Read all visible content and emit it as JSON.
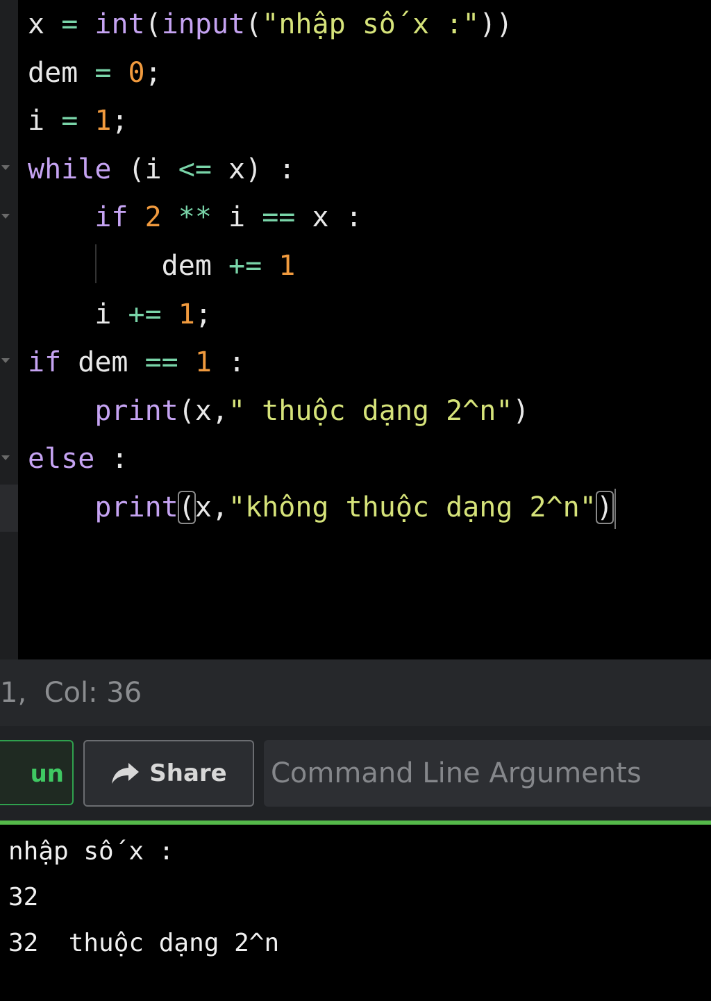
{
  "editor": {
    "lines": [
      [
        {
          "t": "x",
          "c": "pl"
        },
        {
          "t": " ",
          "c": "pl"
        },
        {
          "t": "=",
          "c": "op"
        },
        {
          "t": " ",
          "c": "pl"
        },
        {
          "t": "int",
          "c": "fn"
        },
        {
          "t": "(",
          "c": "pl"
        },
        {
          "t": "input",
          "c": "fn"
        },
        {
          "t": "(",
          "c": "pl"
        },
        {
          "t": "\"nhập số x :\"",
          "c": "str"
        },
        {
          "t": "))",
          "c": "pl"
        }
      ],
      [
        {
          "t": "dem",
          "c": "pl"
        },
        {
          "t": " ",
          "c": "pl"
        },
        {
          "t": "=",
          "c": "op"
        },
        {
          "t": " ",
          "c": "pl"
        },
        {
          "t": "0",
          "c": "num"
        },
        {
          "t": ";",
          "c": "pl"
        }
      ],
      [
        {
          "t": "i",
          "c": "pl"
        },
        {
          "t": " ",
          "c": "pl"
        },
        {
          "t": "=",
          "c": "op"
        },
        {
          "t": " ",
          "c": "pl"
        },
        {
          "t": "1",
          "c": "num"
        },
        {
          "t": ";",
          "c": "pl"
        }
      ],
      [
        {
          "t": "while",
          "c": "kw"
        },
        {
          "t": " (i ",
          "c": "pl"
        },
        {
          "t": "<=",
          "c": "op"
        },
        {
          "t": " x) :",
          "c": "pl"
        }
      ],
      [
        {
          "t": "    ",
          "c": "pl"
        },
        {
          "t": "if",
          "c": "kw"
        },
        {
          "t": " ",
          "c": "pl"
        },
        {
          "t": "2",
          "c": "num"
        },
        {
          "t": " ",
          "c": "pl"
        },
        {
          "t": "**",
          "c": "op"
        },
        {
          "t": " i ",
          "c": "pl"
        },
        {
          "t": "==",
          "c": "op"
        },
        {
          "t": " x :",
          "c": "pl"
        }
      ],
      [
        {
          "t": "        dem ",
          "c": "pl"
        },
        {
          "t": "+=",
          "c": "op"
        },
        {
          "t": " ",
          "c": "pl"
        },
        {
          "t": "1",
          "c": "num"
        }
      ],
      [
        {
          "t": "    i ",
          "c": "pl"
        },
        {
          "t": "+=",
          "c": "op"
        },
        {
          "t": " ",
          "c": "pl"
        },
        {
          "t": "1",
          "c": "num"
        },
        {
          "t": ";",
          "c": "pl"
        }
      ],
      [
        {
          "t": "if",
          "c": "kw"
        },
        {
          "t": " dem ",
          "c": "pl"
        },
        {
          "t": "==",
          "c": "op"
        },
        {
          "t": " ",
          "c": "pl"
        },
        {
          "t": "1",
          "c": "num"
        },
        {
          "t": " :",
          "c": "pl"
        }
      ],
      [
        {
          "t": "    ",
          "c": "pl"
        },
        {
          "t": "print",
          "c": "fn"
        },
        {
          "t": "(x,",
          "c": "pl"
        },
        {
          "t": "\" thuộc dạng 2^n\"",
          "c": "str"
        },
        {
          "t": ")",
          "c": "pl"
        }
      ],
      [
        {
          "t": "else",
          "c": "kw"
        },
        {
          "t": " :",
          "c": "pl"
        }
      ],
      [
        {
          "t": "    ",
          "c": "pl"
        },
        {
          "t": "print",
          "c": "fn"
        },
        {
          "t": "(",
          "c": "pl",
          "bm": true
        },
        {
          "t": "x,",
          "c": "pl"
        },
        {
          "t": "\"không thuộc dạng 2^n\"",
          "c": "str"
        },
        {
          "t": ")",
          "c": "pl",
          "bm": true
        },
        {
          "t": "",
          "c": "cursor"
        }
      ]
    ]
  },
  "status": {
    "position": "1,  Col: 36"
  },
  "toolbar": {
    "run_label": "un",
    "share_label": "Share",
    "args_placeholder": "Command Line Arguments"
  },
  "console": {
    "lines": [
      "nhập số x :",
      "32",
      "32  thuộc dạng 2^n"
    ]
  },
  "colors": {
    "accent": "#55b94a",
    "run_green": "#3fc862"
  }
}
